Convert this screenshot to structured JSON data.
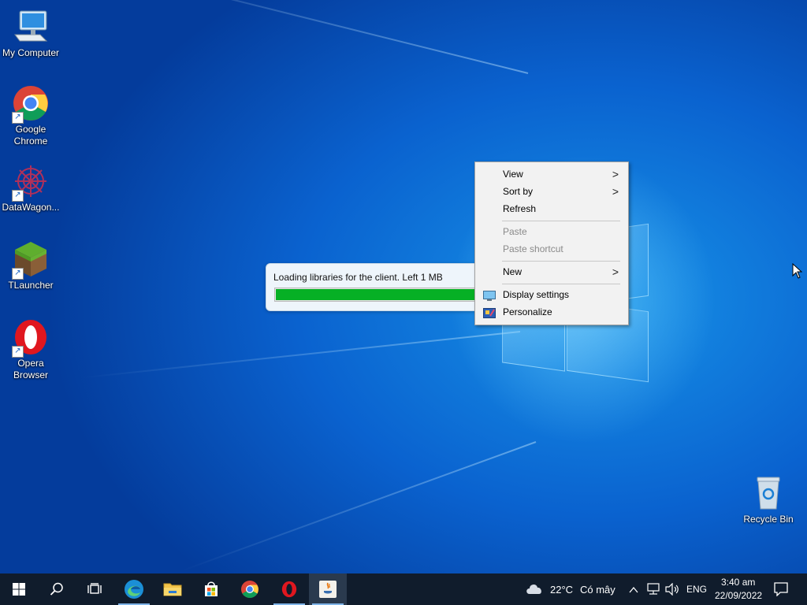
{
  "desktop": {
    "icons": [
      {
        "label": "My Computer",
        "icon": "computer-icon"
      },
      {
        "label": "Google\nChrome",
        "icon": "chrome-icon"
      },
      {
        "label": "DataWagon...",
        "icon": "datawagon-icon"
      },
      {
        "label": "TLauncher",
        "icon": "minecraft-block-icon"
      },
      {
        "label": "Opera\nBrowser",
        "icon": "opera-icon"
      },
      {
        "label": "Recycle Bin",
        "icon": "recycle-bin-icon"
      }
    ]
  },
  "progress_dialog": {
    "message": "Loading libraries for the client. Left 1 MB",
    "progress_percent": 98,
    "bar_color": "#06b025"
  },
  "context_menu": {
    "items": [
      {
        "label": "View",
        "submenu": true,
        "enabled": true
      },
      {
        "label": "Sort by",
        "submenu": true,
        "enabled": true
      },
      {
        "label": "Refresh",
        "submenu": false,
        "enabled": true
      },
      {
        "label": "Paste",
        "submenu": false,
        "enabled": false
      },
      {
        "label": "Paste shortcut",
        "submenu": false,
        "enabled": false
      },
      {
        "label": "New",
        "submenu": true,
        "enabled": true
      },
      {
        "label": "Display settings",
        "submenu": false,
        "enabled": true,
        "icon": "display-icon"
      },
      {
        "label": "Personalize",
        "submenu": false,
        "enabled": true,
        "icon": "personalize-icon"
      }
    ],
    "submenu_glyph": ">"
  },
  "taskbar": {
    "buttons": [
      {
        "name": "start",
        "icon": "windows-logo-icon"
      },
      {
        "name": "search",
        "icon": "search-icon"
      },
      {
        "name": "task-view",
        "icon": "task-view-icon"
      },
      {
        "name": "edge",
        "icon": "edge-icon",
        "active": true
      },
      {
        "name": "file-explorer",
        "icon": "folder-icon"
      },
      {
        "name": "store",
        "icon": "store-icon"
      },
      {
        "name": "chrome",
        "icon": "chrome-icon"
      },
      {
        "name": "opera",
        "icon": "opera-icon",
        "active": true
      },
      {
        "name": "java",
        "icon": "java-icon",
        "active": true
      }
    ],
    "weather": {
      "temperature": "22°C",
      "condition": "Có mây",
      "icon": "cloud-icon"
    },
    "language": "ENG",
    "clock": {
      "time": "3:40 am",
      "date": "22/09/2022"
    }
  },
  "colors": {
    "taskbar_bg": "#101c2c",
    "desktop_blue": "#0a62cf",
    "accent": "#7fb4e8"
  }
}
